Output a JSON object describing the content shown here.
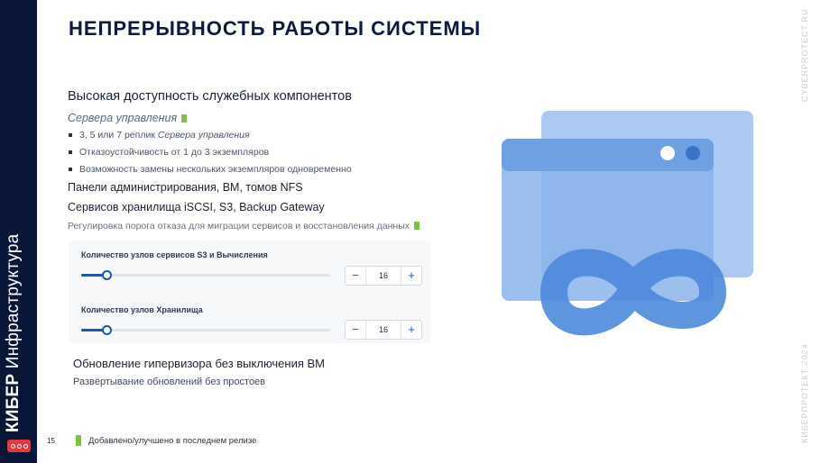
{
  "sidebar": {
    "brand_bold": "КИБЕР",
    "brand_rest": " Инфраструктура"
  },
  "title": "НЕПРЕРЫВНОСТЬ РАБОТЫ СИСТЕМЫ",
  "side_top": "CYBERPROTECT.RU",
  "side_bottom": "КИБЕРПРОТЕКТ 2024",
  "section1": {
    "heading": "Высокая доступность служебных компонентов",
    "subheading": "Сервера управления",
    "bullets": [
      {
        "text": "3, 5 или 7 реплик ",
        "italic": "Сервера управления"
      },
      {
        "text": "Отказоустойчивость от 1 до 3 экземпляров"
      },
      {
        "text": "Возможность замены нескольких экземпляров одновременно"
      }
    ],
    "line1": "Панели администрирования, ВМ, томов NFS",
    "line2": "Сервисов хранилища iSCSI, S3, Backup Gateway",
    "note": "Регулировка порога отказа для миграции сервисов и восстановления данных"
  },
  "panel": {
    "rows": [
      {
        "label": "Количество узлов сервисов S3 и Вычисления",
        "value": "16",
        "minus": "−",
        "plus": "+",
        "level": 0.1
      },
      {
        "label": "Количество узлов Хранилища",
        "value": "16",
        "minus": "−",
        "plus": "+",
        "level": 0.1
      }
    ]
  },
  "section2": {
    "heading": "Обновление гипервизора без выключения ВМ",
    "text": "Развёртывание обновлений без простоев"
  },
  "footer": {
    "page": "15",
    "legend": "Добавлено/улучшено в последнем релизе"
  },
  "colors": {
    "navy": "#0a1638",
    "accent_green": "#7dc242",
    "slider_blue": "#1e56b0",
    "illustration_blue": "#6b9de0"
  }
}
